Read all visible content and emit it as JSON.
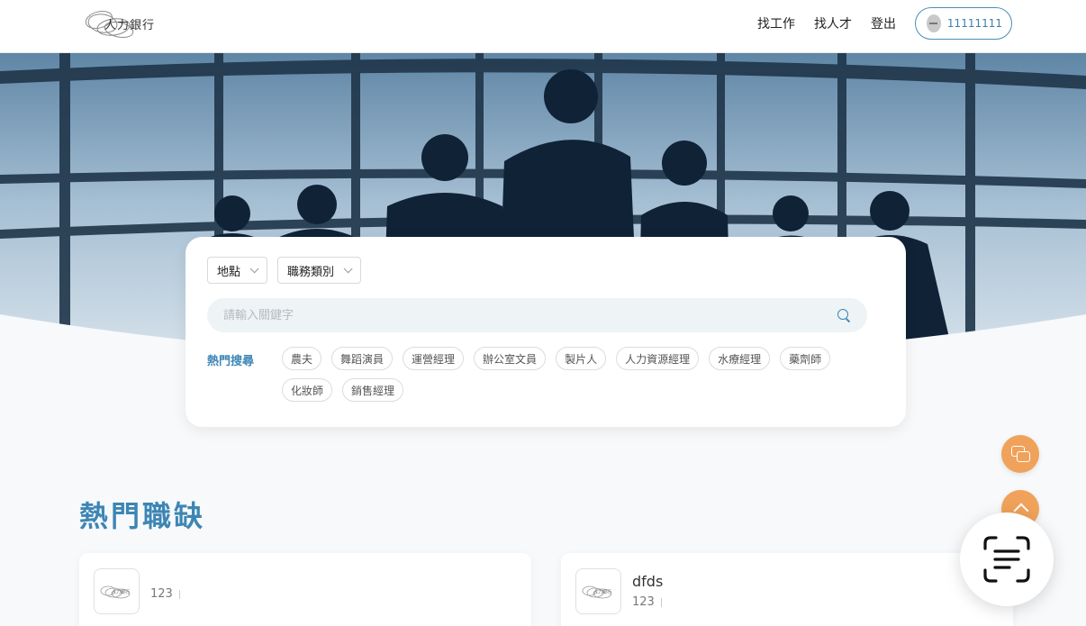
{
  "header": {
    "logo_text": "人力銀行",
    "nav": {
      "find_job": "找工作",
      "find_talent": "找人才",
      "logout": "登出"
    },
    "user": {
      "name": "11111111"
    }
  },
  "search": {
    "location_label": "地點",
    "category_label": "職務類別",
    "placeholder": "請輸入關鍵字",
    "hot_label": "熱門搜尋",
    "hot_tags": [
      "農夫",
      "舞蹈演員",
      "運營經理",
      "辦公室文員",
      "製片人",
      "人力資源經理",
      "水療經理",
      "藥劑師",
      "化妝師",
      "銷售經理"
    ]
  },
  "section": {
    "title": "熱門職缺"
  },
  "jobs": [
    {
      "title": "",
      "company": "123",
      "logo_text": "人力銀行"
    },
    {
      "title": "dfds",
      "company": "123",
      "logo_text": "人力銀行"
    }
  ],
  "colors": {
    "accent": "#3d86b4",
    "fab": "#f0a25a"
  },
  "icons": {
    "search": "search-icon",
    "chat": "chat-icon",
    "back_to_top": "arrow-up-icon",
    "scan": "scan-text-icon"
  }
}
